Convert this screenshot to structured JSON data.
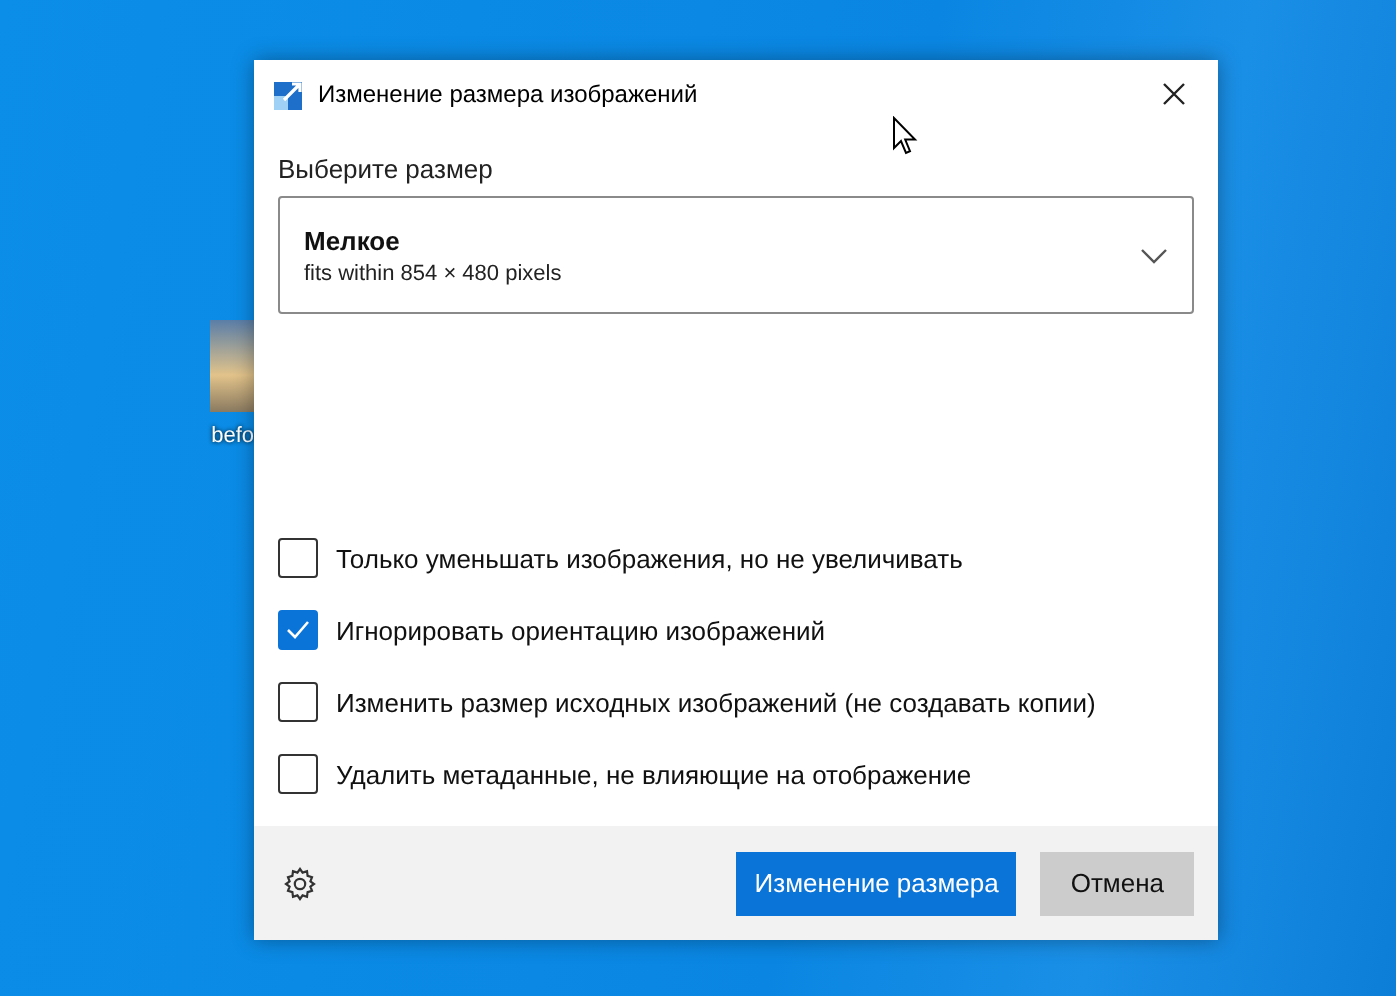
{
  "desktop": {
    "icons": [
      {
        "label": "befo"
      }
    ]
  },
  "window": {
    "title": "Изменение размера изображений"
  },
  "size_label": "Выберите размер",
  "size_dropdown": {
    "name": "Мелкое",
    "description": "fits within 854 × 480 pixels"
  },
  "options": [
    {
      "label": "Только уменьшать изображения, но не увеличивать",
      "checked": false
    },
    {
      "label": "Игнорировать ориентацию изображений",
      "checked": true
    },
    {
      "label": "Изменить размер исходных изображений (не создавать копии)",
      "checked": false
    },
    {
      "label": "Удалить метаданные, не влияющие на отображение",
      "checked": false
    }
  ],
  "buttons": [
    {
      "label": "Изменение размера",
      "kind": "primary"
    },
    {
      "label": "Отмена",
      "kind": "secondary"
    }
  ]
}
